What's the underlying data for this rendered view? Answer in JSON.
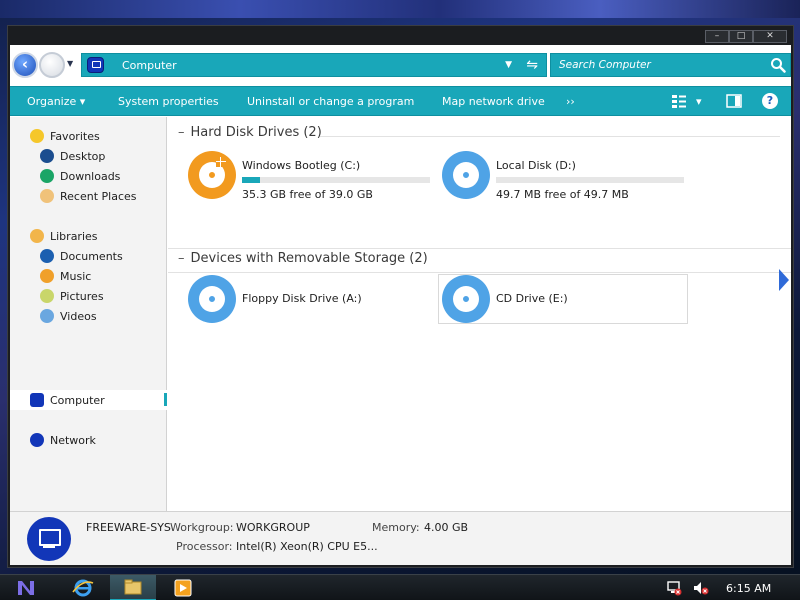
{
  "window": {
    "min": "–",
    "max": "□",
    "close": "✕"
  },
  "address": {
    "path": "Computer",
    "dropdown": "▼",
    "refresh": "⇋"
  },
  "search": {
    "placeholder": "Search Computer"
  },
  "toolbar": {
    "organize": "Organize ▾",
    "system_properties": "System properties",
    "uninstall": "Uninstall or change a program",
    "map_drive": "Map network drive",
    "more": "››",
    "view_dd": "▾",
    "help": "?"
  },
  "sidebar": {
    "favorites": "Favorites",
    "desktop": "Desktop",
    "downloads": "Downloads",
    "recent": "Recent Places",
    "libraries": "Libraries",
    "documents": "Documents",
    "music": "Music",
    "pictures": "Pictures",
    "videos": "Videos",
    "computer": "Computer",
    "network": "Network"
  },
  "groups": {
    "hdd": "Hard Disk Drives (2)",
    "removable": "Devices with Removable Storage (2)",
    "collapse": "–"
  },
  "drives": [
    {
      "name": "Windows Bootleg (C:)",
      "free_text": "35.3 GB free of 39.0 GB",
      "used_fraction": 0.095
    },
    {
      "name": "Local Disk (D:)",
      "free_text": "49.7 MB free of 49.7 MB",
      "used_fraction": 0.0
    },
    {
      "name": "Floppy Disk Drive (A:)"
    },
    {
      "name": "CD Drive (E:)"
    }
  ],
  "details": {
    "computer_name": "FREEWARE-SYS",
    "workgroup_label": "Workgroup:",
    "workgroup_value": "WORKGROUP",
    "memory_label": "Memory:",
    "memory_value": "4.00 GB",
    "processor_label": "Processor:",
    "processor_value": "Intel(R) Xeon(R) CPU E5..."
  },
  "taskbar": {
    "clock": "6:15 AM"
  },
  "colors": {
    "accent": "#19a7b9",
    "disc_blue": "#4fa3e6",
    "disc_orange": "#f29a1f"
  }
}
